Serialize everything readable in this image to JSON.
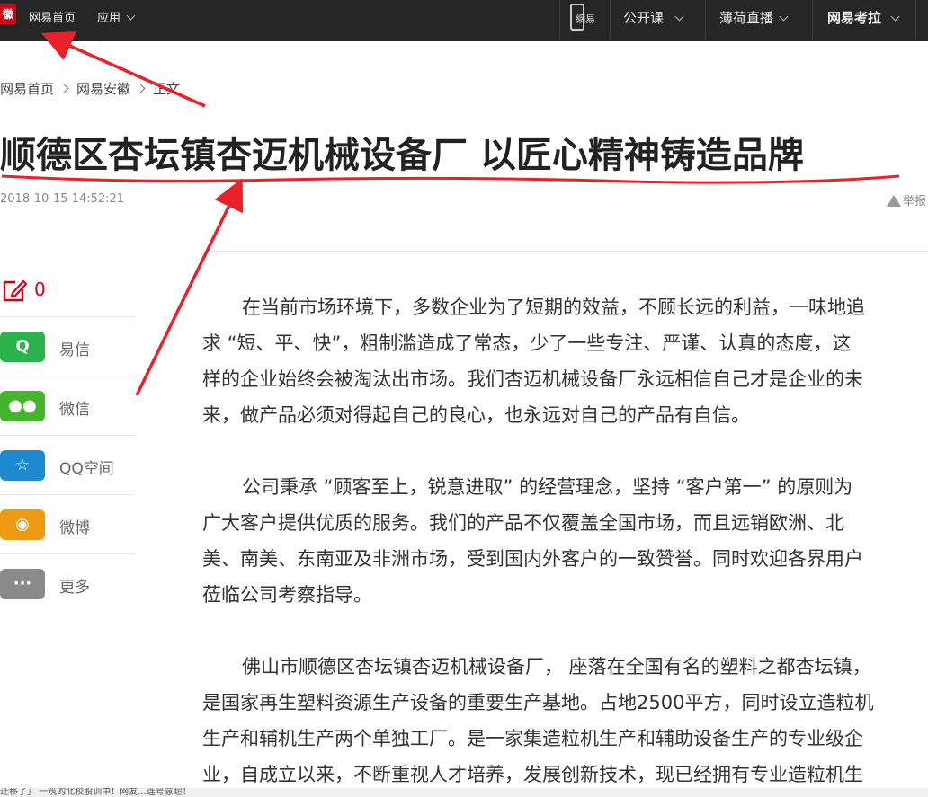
{
  "topbar": {
    "logo": "徽",
    "nav_home": "网易首页",
    "nav_apps": "应用",
    "phone_label": "網易",
    "open_course": "公开课",
    "bohe_live": "薄荷直播",
    "kaola": "网易考拉"
  },
  "breadcrumb": {
    "items": [
      "网易首页",
      "网易安徽",
      "正文"
    ]
  },
  "article": {
    "title": "顺德区杏坛镇杏迈机械设备厂 以匠心精神铸造品牌",
    "date": "2018-10-15 14:52:21",
    "report_label": "举报",
    "paragraphs": [
      {
        "lines": [
          "在当前市场环境下，多数企业为了短期的效益，不顾长远的利益，一味地追",
          "求 “短、平、快”，粗制滥造成了常态，少了一些专注、严谨、认真的态度，这",
          "样的企业始终会被淘汰出市场。我们杏迈机械设备厂永远相信自己才是企业的未",
          "来，做产品必须对得起自己的良心，也永远对自己的产品有自信。"
        ]
      },
      {
        "lines": [
          "公司秉承 “顾客至上，锐意进取” 的经营理念，坚持 “客户第一” 的原则为",
          "广大客户提供优质的服务。我们的产品不仅覆盖全国市场，而且远销欧洲、北",
          "美、南美、东南亚及非洲市场，受到国内外客户的一致赞誉。同时欢迎各界用户",
          "莅临公司考察指导。"
        ]
      },
      {
        "lines": [
          "佛山市顺德区杏坛镇杏迈机械设备厂， 座落在全国有名的塑料之都杏坛镇，",
          "是国家再生塑料资源生产设备的重要生产基地。占地2500平方，同时设立造粒机",
          "生产和辅机生产两个单独工厂。是一家集造粒机生产和辅助设备生产的专业级企",
          "业，自成立以来，不断重视人才培养，发展创新技术，现已经拥有专业造粒机生"
        ]
      }
    ]
  },
  "share": {
    "comment_count": "0",
    "items": [
      {
        "label": "易信",
        "icon": "yixin-icon",
        "color": "#2bb24c",
        "glyph": "Q"
      },
      {
        "label": "微信",
        "icon": "wechat-icon",
        "color": "#46b42d",
        "glyph": "●●"
      },
      {
        "label": "QQ空间",
        "icon": "qzone-icon",
        "color": "#1e88d0",
        "glyph": "☆"
      },
      {
        "label": "微博",
        "icon": "weibo-icon",
        "color": "#eb9a12",
        "glyph": "◉"
      },
      {
        "label": "更多",
        "icon": "more-icon",
        "color": "#8a8a8a",
        "glyph": "···"
      }
    ]
  },
  "status_text": "迁移了」 一筑的北校股训中！网友...连号意超！",
  "colors": {
    "topbar_bg": "#262626",
    "accent_red": "#e8212b",
    "comment_red": "#d0021b"
  }
}
